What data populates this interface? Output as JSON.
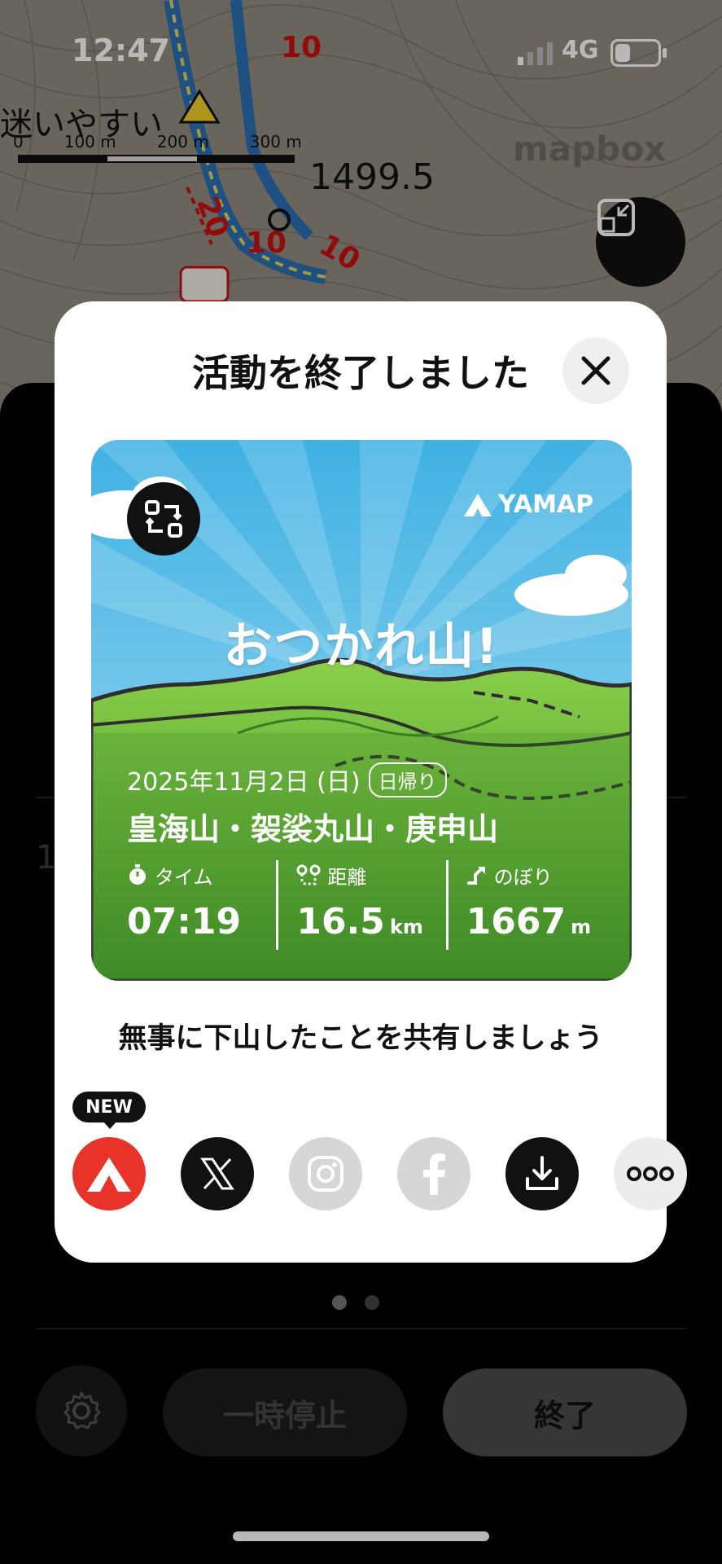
{
  "status_bar": {
    "time": "12:47",
    "network": "4G"
  },
  "map": {
    "warning_text": "迷いやすい",
    "scale_labels": [
      "0",
      "100 m",
      "200 m",
      "300 m"
    ],
    "elevation": "1499.5",
    "attribution": "mapbox",
    "trail_times": [
      "10",
      "20",
      "10",
      "10"
    ]
  },
  "modal": {
    "title": "活動を終了しました",
    "card": {
      "brand": "YAMAP",
      "headline": "おつかれ山!",
      "date": "2025年11月2日 (日)",
      "trip_type": "日帰り",
      "mountains": "皇海山・袈裟丸山・庚申山",
      "stats": [
        {
          "label": "タイム",
          "value": "07:19",
          "unit": "",
          "icon": "stopwatch-icon"
        },
        {
          "label": "距離",
          "value": "16.5",
          "unit": "km",
          "icon": "route-icon"
        },
        {
          "label": "のぼり",
          "value": "1667",
          "unit": "m",
          "icon": "ascent-icon"
        }
      ]
    },
    "share_prompt": "無事に下山したことを共有しましょう",
    "new_badge": "NEW",
    "share_targets": [
      "yamap",
      "x",
      "instagram",
      "facebook",
      "download",
      "more"
    ],
    "colors": {
      "yamap_red": "#e8332a",
      "sky": "#6cc6ec",
      "grass": "#5fa83a"
    }
  },
  "sheet": {
    "pause_label": "一時停止",
    "end_label": "終了",
    "page_index": 0,
    "page_count": 2
  }
}
